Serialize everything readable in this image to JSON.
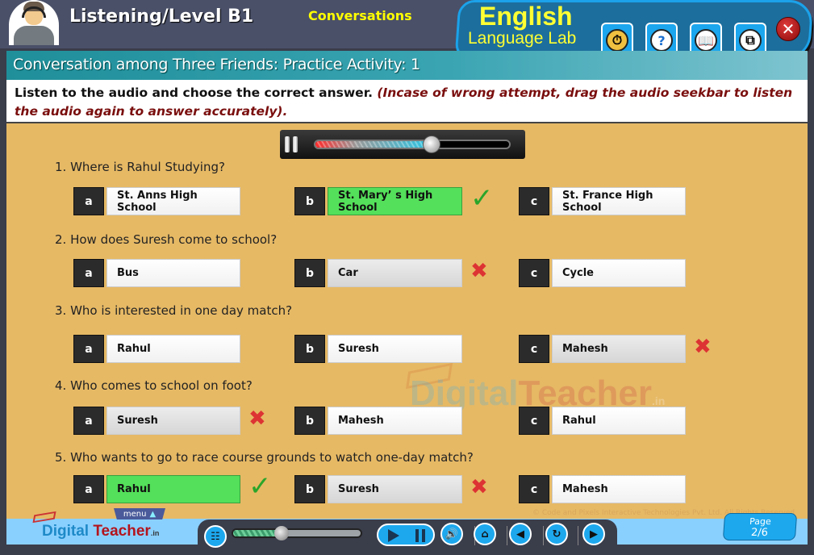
{
  "header": {
    "level_title": "Listening/Level B1",
    "section_label": "Conversations",
    "brand_line1": "English",
    "brand_line2": "Language Lab",
    "toolbar": [
      {
        "name": "history-icon",
        "glyph": "⏱"
      },
      {
        "name": "help-icon",
        "glyph": "?"
      },
      {
        "name": "book-icon",
        "glyph": "📖"
      },
      {
        "name": "window-resize-icon",
        "glyph": "⧉"
      }
    ],
    "close_glyph": "✕"
  },
  "subtitle": "Conversation among Three Friends: Practice Activity: 1",
  "instruction": {
    "main": "Listen to the audio and choose the correct answer. ",
    "note": "(Incase of wrong attempt, drag the audio seekbar to listen the audio again to answer accurately)."
  },
  "audio": {
    "progress": 0.6,
    "state": "playing"
  },
  "questions": [
    {
      "text": "1. Where is Rahul Studying?",
      "options": [
        {
          "letter": "a",
          "label": "St. Anns High School",
          "state": "none"
        },
        {
          "letter": "b",
          "label": "St. Mary’ s High School",
          "state": "correct"
        },
        {
          "letter": "c",
          "label": "St. France High School",
          "state": "none"
        }
      ]
    },
    {
      "text": "2. How does Suresh come to school?",
      "options": [
        {
          "letter": "a",
          "label": "Bus",
          "state": "none"
        },
        {
          "letter": "b",
          "label": "Car",
          "state": "wrong"
        },
        {
          "letter": "c",
          "label": "Cycle",
          "state": "none"
        }
      ]
    },
    {
      "text": "3. Who is interested in one day match?",
      "options": [
        {
          "letter": "a",
          "label": "Rahul",
          "state": "none"
        },
        {
          "letter": "b",
          "label": "Suresh",
          "state": "none"
        },
        {
          "letter": "c",
          "label": "Mahesh",
          "state": "wrong"
        }
      ]
    },
    {
      "text": "4. Who comes to school on foot?",
      "options": [
        {
          "letter": "a",
          "label": "Suresh",
          "state": "wrong"
        },
        {
          "letter": "b",
          "label": "Mahesh",
          "state": "none"
        },
        {
          "letter": "c",
          "label": "Rahul",
          "state": "none"
        }
      ]
    },
    {
      "text": "5. Who wants to go to race course grounds to watch one-day match?",
      "options": [
        {
          "letter": "a",
          "label": "Rahul",
          "state": "correct"
        },
        {
          "letter": "b",
          "label": "Suresh",
          "state": "wrong"
        },
        {
          "letter": "c",
          "label": "Mahesh",
          "state": "none"
        }
      ]
    }
  ],
  "marks": {
    "tick": "✓",
    "cross": "✖"
  },
  "watermark": {
    "part1": "Digital",
    "part2": "Teacher",
    "suffix": ".in"
  },
  "footer": {
    "logo_part1": "Digital",
    "logo_part2": "Teacher",
    "logo_suffix": ".in",
    "menu_label": "menu",
    "menu_arrow": "▲",
    "copyright": "© Code and Pixels Interactive Technologies  Pvt. Ltd. All Rights Reserved",
    "nav_progress": 0.35,
    "controls": [
      {
        "name": "volume-icon",
        "glyph": "🔊"
      },
      {
        "name": "home-icon",
        "glyph": "⌂"
      },
      {
        "name": "previous-icon",
        "glyph": "◀"
      },
      {
        "name": "replay-icon",
        "glyph": "↻"
      },
      {
        "name": "next-icon",
        "glyph": "▶"
      }
    ],
    "page_label": "Page",
    "page_value": "2/6"
  }
}
